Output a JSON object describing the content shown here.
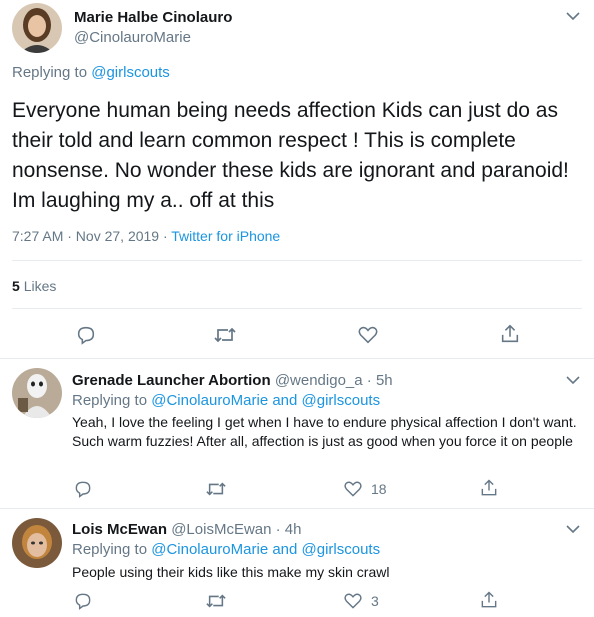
{
  "main_tweet": {
    "author_name": "Marie Halbe Cinolauro",
    "handle": "@CinolauroMarie",
    "replying_prefix": "Replying to",
    "replying_to": "@girlscouts",
    "text": "Everyone human being needs affection Kids can just do as their told and learn common respect ! This is complete nonsense. No wonder these kids are ignorant and paranoid! Im laughing my a.. off at this",
    "time": "7:27 AM · Nov 27, 2019 ·",
    "source": "Twitter for iPhone",
    "likes_count": "5",
    "likes_label": "Likes"
  },
  "replies": [
    {
      "author_name": "Grenade Launcher Abortion",
      "handle": "@wendigo_a",
      "time": "· 5h",
      "replying_prefix": "Replying to",
      "replying_to": "@CinolauroMarie and @girlscouts",
      "text": "Yeah, I love the feeling I get when I have to endure physical affection I don't want. Such warm fuzzies! After all, affection is just as good when you force it on people",
      "like_count": "18"
    },
    {
      "author_name": "Lois McEwan",
      "handle": "@LoisMcEwan",
      "time": "· 4h",
      "replying_prefix": "Replying to",
      "replying_to": "@CinolauroMarie and @girlscouts",
      "text": "People using their kids like this make my skin crawl",
      "like_count": "3"
    }
  ],
  "icons": {
    "reply": "comment-icon",
    "retweet": "retweet-icon",
    "like": "heart-icon",
    "share": "share-icon",
    "more": "chevron-down-icon"
  },
  "colors": {
    "link": "#1b95e0",
    "muted": "#657786",
    "text": "#14171a",
    "divider": "#e6ecf0"
  }
}
